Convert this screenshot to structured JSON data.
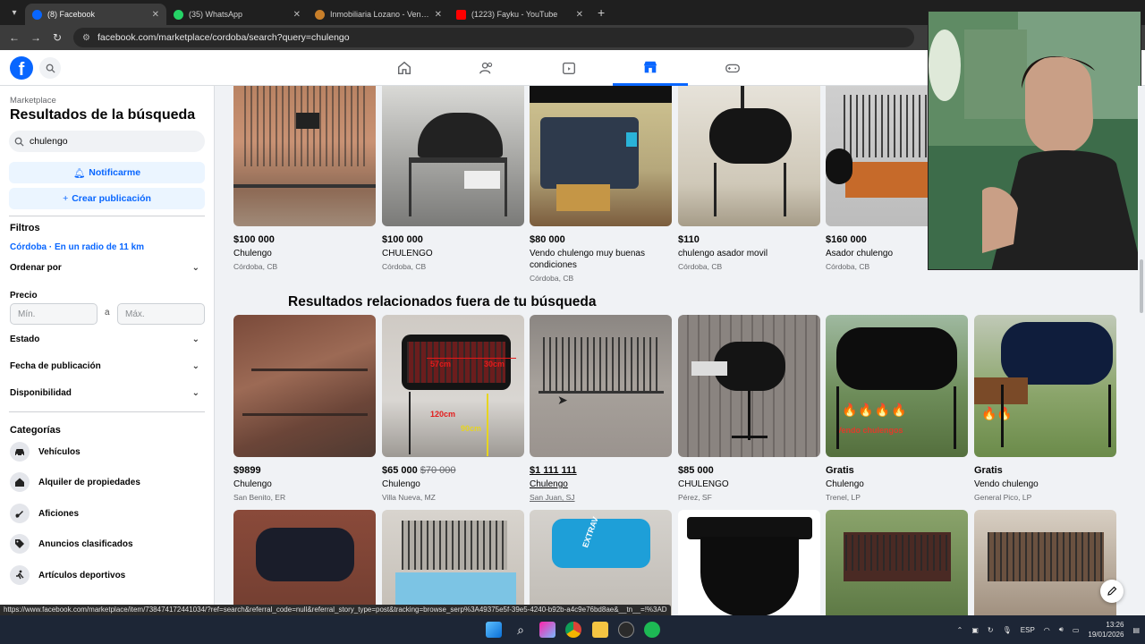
{
  "browser": {
    "tabs": [
      {
        "label": "(8) Facebook",
        "color": "#0866ff",
        "active": true
      },
      {
        "label": "(35) WhatsApp",
        "color": "#25d366",
        "active": false
      },
      {
        "label": "Inmobiliaria Lozano - Venta y A",
        "color": "#c87f2a",
        "active": false
      },
      {
        "label": "(1223) Fayku - YouTube",
        "color": "#ff0000",
        "active": false
      }
    ],
    "url": "facebook.com/marketplace/cordoba/search?query=chulengo",
    "status_url": "https://www.facebook.com/marketplace/item/738474172441034/?ref=search&referral_code=null&referral_story_type=post&tracking=browse_serp%3A49375e5f-39e5-4240-b92b-a4c9e76bd8ae&__tn__=!%3AD"
  },
  "sidebar": {
    "kicker": "Marketplace",
    "title": "Resultados de la búsqueda",
    "search_value": "chulengo",
    "notify_label": "Notificarme",
    "create_label": "Crear publicación",
    "filters_heading": "Filtros",
    "location": "Córdoba · En un radio de 11 km",
    "sort_label": "Ordenar por",
    "price_label": "Precio",
    "price_min_placeholder": "Mín.",
    "price_sep": "a",
    "price_max_placeholder": "Máx.",
    "condition_label": "Estado",
    "date_label": "Fecha de publicación",
    "availability_label": "Disponibilidad",
    "categories_heading": "Categorías",
    "categories": [
      {
        "label": "Vehículos",
        "icon": "car-icon"
      },
      {
        "label": "Alquiler de propiedades",
        "icon": "house-icon"
      },
      {
        "label": "Aficiones",
        "icon": "guitar-icon"
      },
      {
        "label": "Anuncios clasificados",
        "icon": "tag-icon"
      },
      {
        "label": "Artículos deportivos",
        "icon": "sports-icon"
      }
    ]
  },
  "main": {
    "related_heading": "Resultados relacionados fuera de tu búsqueda",
    "row1": [
      {
        "price": "$100 000",
        "title": "Chulengo",
        "loc": "Córdoba, CB"
      },
      {
        "price": "$100 000",
        "title": "CHULENGO",
        "loc": "Córdoba, CB"
      },
      {
        "price": "$80 000",
        "title": "Vendo chulengo muy buenas condiciones",
        "loc": "Córdoba, CB"
      },
      {
        "price": "$110",
        "title": "chulengo asador movil",
        "loc": "Córdoba, CB"
      },
      {
        "price": "$160 000",
        "title": "Asador chulengo",
        "loc": "Córdoba, CB"
      }
    ],
    "row2": [
      {
        "price": "$9899",
        "old_price": "",
        "title": "Chulengo",
        "loc": "San Benito, ER"
      },
      {
        "price": "$65 000",
        "old_price": "$70 000",
        "title": "Chulengo",
        "loc": "Villa Nueva, MZ"
      },
      {
        "price": "$1 111 111",
        "old_price": "",
        "title": "Chulengo",
        "loc": "San Juan, SJ"
      },
      {
        "price": "$85 000",
        "old_price": "",
        "title": "CHULENGO",
        "loc": "Pérez, SF"
      },
      {
        "price": "Gratis",
        "old_price": "",
        "title": "Chulengo",
        "loc": "Trenel, LP"
      },
      {
        "price": "Gratis",
        "old_price": "",
        "title": "Vendo chulengo",
        "loc": "General Pico, LP"
      }
    ],
    "img_text": {
      "dim1": "57cm",
      "dim2": "30cm",
      "dim3": "120cm",
      "dim4": "90cm",
      "flames_caption": "Vendo chulengos",
      "drum_text": "EXTRAV"
    }
  },
  "taskbar": {
    "lang": "ESP",
    "time": "13:26",
    "date": "19/01/2026"
  },
  "colors": {
    "fb_blue": "#0866ff",
    "light_blue": "#ebf5ff"
  }
}
